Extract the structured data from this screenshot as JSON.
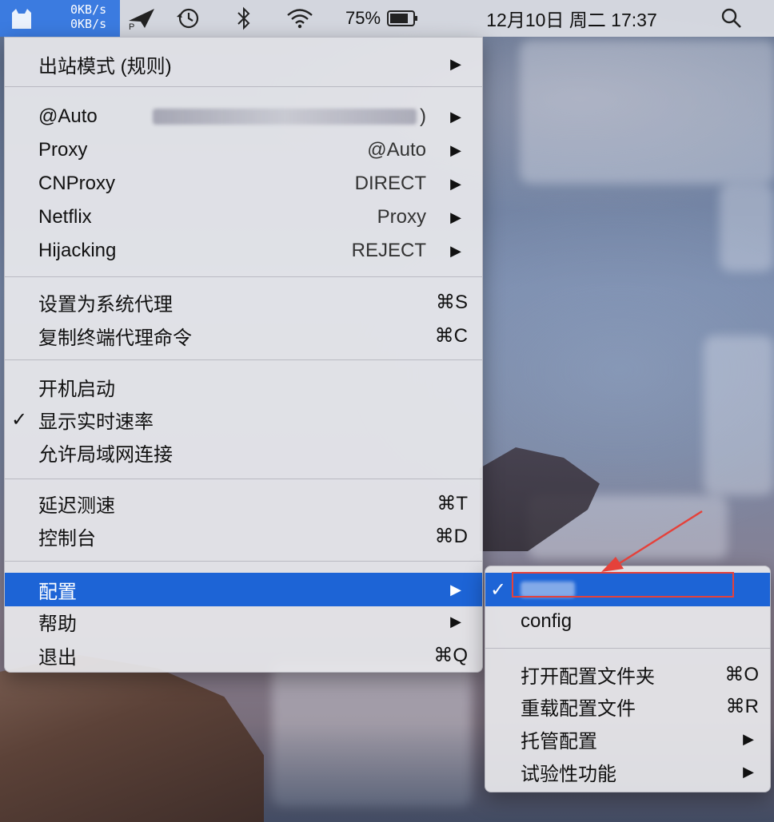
{
  "menubar": {
    "speed_up": "0KB/s",
    "speed_down": "0KB/s",
    "battery": "75%",
    "datetime": "12月10日 周二 17:37",
    "icons": [
      "clashx-cat-icon",
      "paper-plane-icon",
      "time-machine-icon",
      "bluetooth-icon",
      "wifi-icon",
      "battery-icon",
      "search-icon"
    ]
  },
  "main_menu": {
    "outbound_mode": "出站模式 (规则)",
    "groups": [
      {
        "label": "@Auto",
        "value": ""
      },
      {
        "label": "Proxy",
        "value": "@Auto"
      },
      {
        "label": "CNProxy",
        "value": "DIRECT"
      },
      {
        "label": "Netflix",
        "value": "Proxy"
      },
      {
        "label": "Hijacking",
        "value": "REJECT"
      }
    ],
    "auto_value_suffix": ")",
    "set_system_proxy": "设置为系统代理",
    "set_system_proxy_shortcut": "⌘S",
    "copy_terminal": "复制终端代理命令",
    "copy_terminal_shortcut": "⌘C",
    "start_at_login": "开机启动",
    "show_speed": "显示实时速率",
    "show_speed_check": "✓",
    "allow_lan": "允许局域网连接",
    "latency_test": "延迟测速",
    "latency_test_shortcut": "⌘T",
    "dashboard": "控制台",
    "dashboard_shortcut": "⌘D",
    "config": "配置",
    "help": "帮助",
    "quit": "退出",
    "quit_shortcut": "⌘Q"
  },
  "sub_menu": {
    "selected_check": "✓",
    "config_item": "config",
    "open_folder": "打开配置文件夹",
    "open_folder_shortcut": "⌘O",
    "reload": "重载配置文件",
    "reload_shortcut": "⌘R",
    "managed": "托管配置",
    "experimental": "试验性功能"
  },
  "colors": {
    "selection": "#1d64d6",
    "highlight_box": "#e5413a"
  }
}
